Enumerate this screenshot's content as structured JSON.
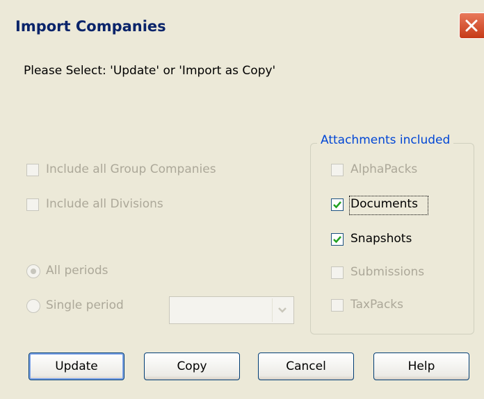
{
  "window": {
    "title": "Import Companies",
    "close_icon": "close-icon"
  },
  "prompt": "Please Select: 'Update' or 'Import as Copy'",
  "options": {
    "include_group_companies": {
      "label": "Include all Group Companies",
      "checked": false,
      "enabled": false
    },
    "include_divisions": {
      "label": "Include all Divisions",
      "checked": false,
      "enabled": false
    }
  },
  "periods": {
    "all_periods": {
      "label": "All periods",
      "selected": true,
      "enabled": false
    },
    "single_period": {
      "label": "Single period",
      "selected": false,
      "enabled": false
    },
    "period_select_value": ""
  },
  "attachments": {
    "legend": "Attachments included",
    "items": [
      {
        "label": "AlphaPacks",
        "checked": false,
        "enabled": false
      },
      {
        "label": "Documents",
        "checked": true,
        "enabled": true
      },
      {
        "label": "Snapshots",
        "checked": true,
        "enabled": true
      },
      {
        "label": "Submissions",
        "checked": false,
        "enabled": false
      },
      {
        "label": "TaxPacks",
        "checked": false,
        "enabled": false
      }
    ]
  },
  "buttons": {
    "update": "Update",
    "copy": "Copy",
    "cancel": "Cancel",
    "help": "Help"
  },
  "colors": {
    "title_text": "#0a246a",
    "legend_text": "#0046d5",
    "disabled_text": "#aca899",
    "check_green": "#21a121",
    "close_button": "#c63a17"
  }
}
